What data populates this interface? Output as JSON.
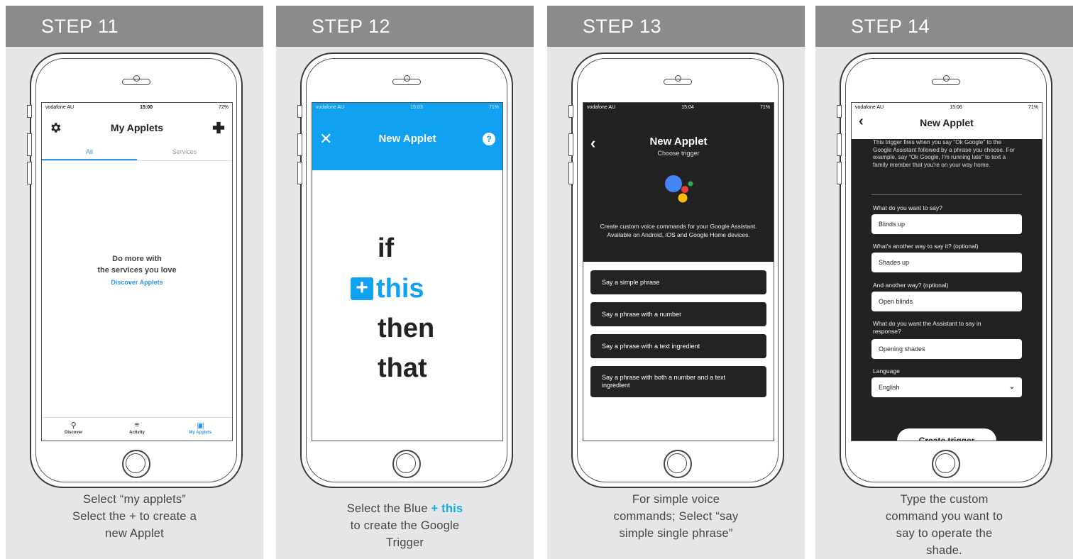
{
  "steps": [
    {
      "label": "STEP 11",
      "caption": [
        "Select “my applets”",
        "Select the + to create a",
        "new Applet"
      ],
      "screen": {
        "status": {
          "carrier": "vodafone AU",
          "time": "15:00",
          "battery": "72%"
        },
        "title": "My Applets",
        "tabs": [
          "All",
          "Services"
        ],
        "empty_line1": "Do more with",
        "empty_line2": "the services you love",
        "link": "Discover Applets",
        "nav": [
          "Discover",
          "Activity",
          "My Applets"
        ]
      }
    },
    {
      "label": "STEP 12",
      "caption_pre": "Select the Blue ",
      "caption_highlight": "+ this",
      "caption_lines": [
        "to create the Google",
        "Trigger"
      ],
      "screen": {
        "status": {
          "carrier": "vodafone AU",
          "time": "15:03",
          "battery": "71%"
        },
        "title": "New Applet",
        "words": [
          "if",
          "this",
          "then",
          "that"
        ],
        "accent": "#10a1f1"
      }
    },
    {
      "label": "STEP 13",
      "caption": [
        "For simple voice",
        "commands; Select “say",
        "simple single phrase”"
      ],
      "screen": {
        "status": {
          "carrier": "vodafone AU",
          "time": "15:04",
          "battery": "71%"
        },
        "title": "New Applet",
        "subtitle": "Choose trigger",
        "description": "Create custom voice commands for your Google Assistant. Available on Android, iOS and Google Home devices.",
        "options": [
          "Say a simple phrase",
          "Say a phrase with a number",
          "Say a phrase with a text ingredient",
          "Say a phrase with both a number and a text ingredient"
        ]
      }
    },
    {
      "label": "STEP 14",
      "caption": [
        "Type the custom",
        "command you want to",
        "say to operate the",
        "shade."
      ],
      "screen": {
        "status": {
          "carrier": "vodafone AU",
          "time": "15:06",
          "battery": "71%"
        },
        "title": "New Applet",
        "description": "This trigger fires when you say \"Ok Google\" to the Google Assistant followed by a phrase you choose. For example, say \"Ok Google, I'm running late\" to text a family member that you're on your way home.",
        "fields": [
          {
            "label": "What do you want to say?",
            "value": "Blinds up"
          },
          {
            "label": "What's another way to say it? (optional)",
            "value": "Shades up"
          },
          {
            "label": "And another way? (optional)",
            "value": "Open blinds"
          },
          {
            "label": "What do you want the Assistant to say in response?",
            "value": "Opening shades"
          },
          {
            "label": "Language",
            "value": "English"
          }
        ],
        "button": "Create trigger"
      }
    }
  ]
}
